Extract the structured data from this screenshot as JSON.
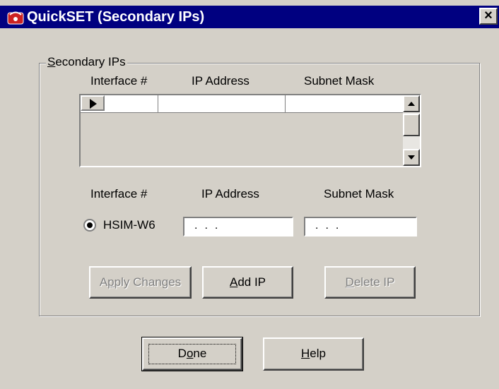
{
  "window": {
    "title": "QuickSET (Secondary IPs)",
    "app_icon": "phone-icon",
    "close_label": "×",
    "colors": {
      "titlebar": "#000080",
      "face": "#d4d0c8",
      "accent_icon": "#cc2222"
    }
  },
  "group": {
    "legend_first": "S",
    "legend_rest": "econdary IPs"
  },
  "grid": {
    "columns": [
      "Interface #",
      "IP Address",
      "Subnet Mask"
    ],
    "rows": [
      {
        "interface": "",
        "ip_address": "",
        "subnet_mask": ""
      }
    ],
    "row_selector_icon": "row-pointer-icon",
    "scroll_up_icon": "scroll-up-icon",
    "scroll_down_icon": "scroll-down-icon"
  },
  "form": {
    "labels": {
      "interface": "Interface #",
      "ip_address": "IP Address",
      "subnet_mask": "Subnet Mask"
    },
    "interface_option": {
      "label": "HSIM-W6",
      "selected": true
    },
    "ip_address_value": "...",
    "subnet_mask_value": "..."
  },
  "buttons": {
    "apply": {
      "pre": "A",
      "ul": "p",
      "post": "ply Changes",
      "enabled": false
    },
    "add": {
      "pre": "",
      "ul": "A",
      "post": "dd IP",
      "enabled": true
    },
    "delete": {
      "pre": "",
      "ul": "D",
      "post": "elete IP",
      "enabled": false
    },
    "done": {
      "pre": "D",
      "ul": "o",
      "post": "ne",
      "default": true
    },
    "help": {
      "pre": "",
      "ul": "H",
      "post": "elp"
    }
  }
}
